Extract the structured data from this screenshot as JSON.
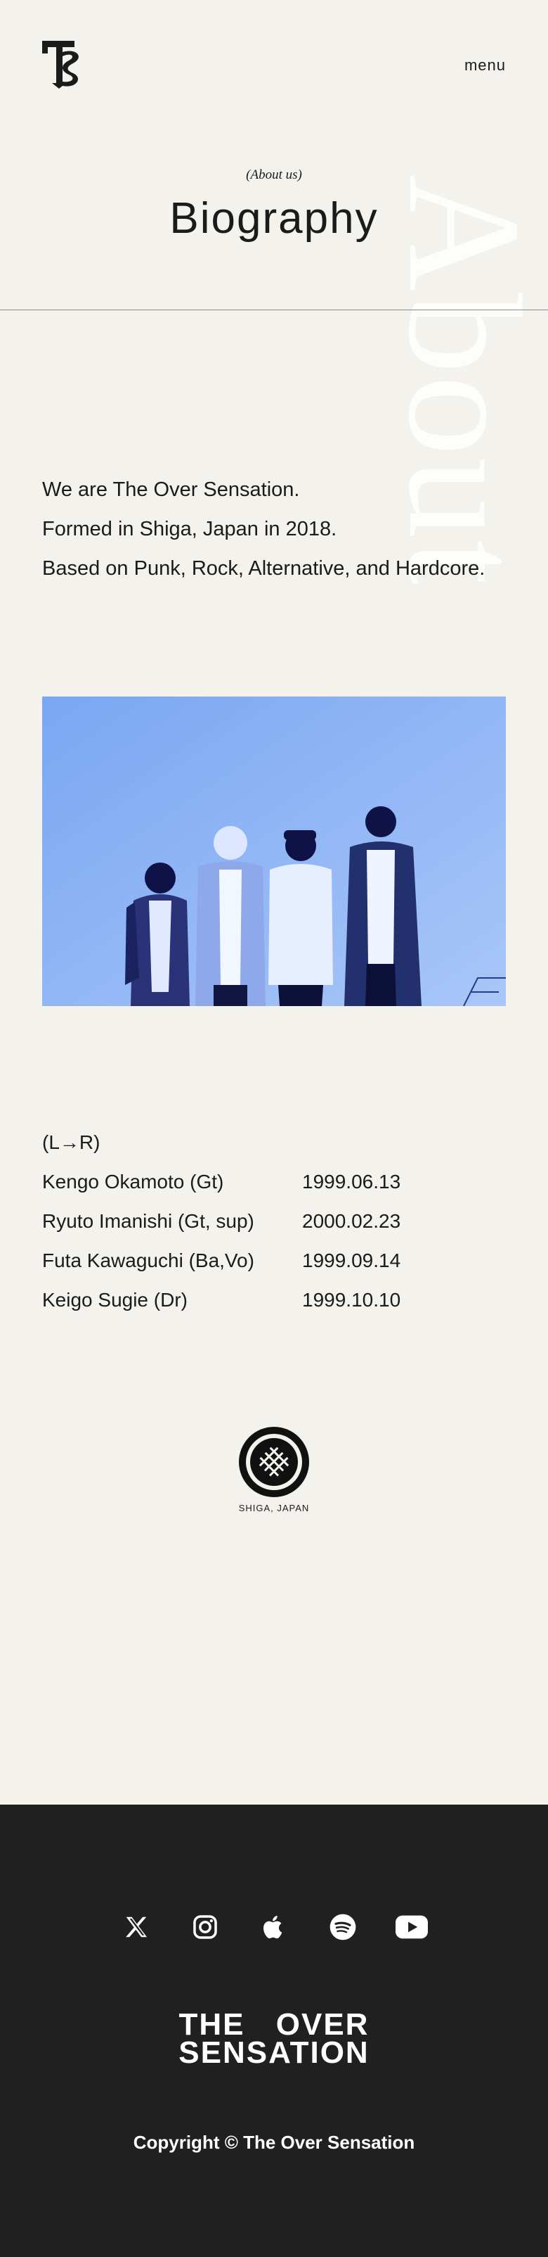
{
  "header": {
    "menu_label": "menu"
  },
  "hero": {
    "tag": "(About us)",
    "title": "Biography",
    "watermark": "About"
  },
  "intro": {
    "lines": [
      "We are The Over Sensation.",
      "Formed in Shiga, Japan in 2018.",
      "Based on Punk, Rock, Alternative, and Hardcore."
    ]
  },
  "members": {
    "order_label": "(L→R)",
    "list": [
      {
        "name": "Kengo Okamoto (Gt)",
        "birthday": "1999.06.13"
      },
      {
        "name": "Ryuto Imanishi (Gt, sup)",
        "birthday": "2000.02.23"
      },
      {
        "name": "Futa Kawaguchi (Ba,Vo)",
        "birthday": "1999.09.14"
      },
      {
        "name": "Keigo Sugie (Dr)",
        "birthday": "1999.10.10"
      }
    ]
  },
  "emblem": {
    "caption": "SHIGA, JAPAN"
  },
  "footer": {
    "socials": [
      "x-icon",
      "instagram-icon",
      "apple-music-icon",
      "spotify-icon",
      "youtube-icon"
    ],
    "logo_line1": "THE OVER",
    "logo_line2": "SENSATION",
    "copyright": "Copyright © The Over Sensation"
  },
  "colors": {
    "background": "#f4f2ed",
    "footer_background": "#202020",
    "photo_tint": "#7fa9f2",
    "text": "#1b1b1b"
  }
}
